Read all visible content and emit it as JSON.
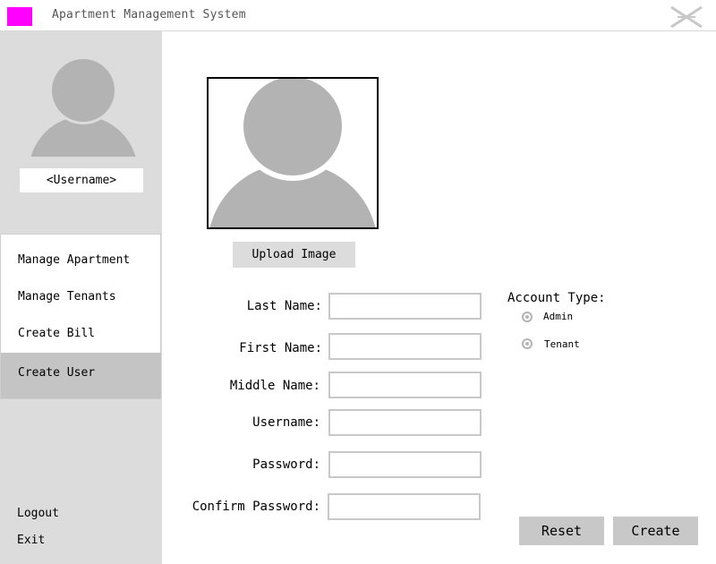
{
  "window": {
    "title": "Apartment Management System",
    "logo_color": "#ff00ff",
    "close_icon": "close-x-icon"
  },
  "sidebar": {
    "username": "<Username>",
    "avatar_icon": "user-avatar-icon",
    "nav_items": [
      {
        "label": "Manage Apartment"
      },
      {
        "label": "Manage Tenants"
      },
      {
        "label": "Create Bill"
      },
      {
        "label": "Create User",
        "active": true
      }
    ],
    "logout_label": "Logout",
    "exit_label": "Exit"
  },
  "form": {
    "photo_icon": "user-avatar-icon",
    "upload_label": "Upload Image",
    "fields": {
      "last_name": {
        "label": "Last Name:",
        "value": ""
      },
      "first_name": {
        "label": "First Name:",
        "value": ""
      },
      "middle_name": {
        "label": "Middle Name:",
        "value": ""
      },
      "username": {
        "label": "Username:",
        "value": ""
      },
      "password": {
        "label": "Password:",
        "value": ""
      },
      "confirm_password": {
        "label": "Confirm Password:",
        "value": ""
      }
    },
    "account_type": {
      "label": "Account Type:",
      "options": [
        "Admin",
        "Tenant"
      ]
    },
    "reset_label": "Reset",
    "create_label": "Create"
  },
  "colors": {
    "sidebar_bg": "#dcdcdc",
    "active_nav_bg": "#c4c4c4",
    "placeholder_gray": "#b3b3b3"
  }
}
